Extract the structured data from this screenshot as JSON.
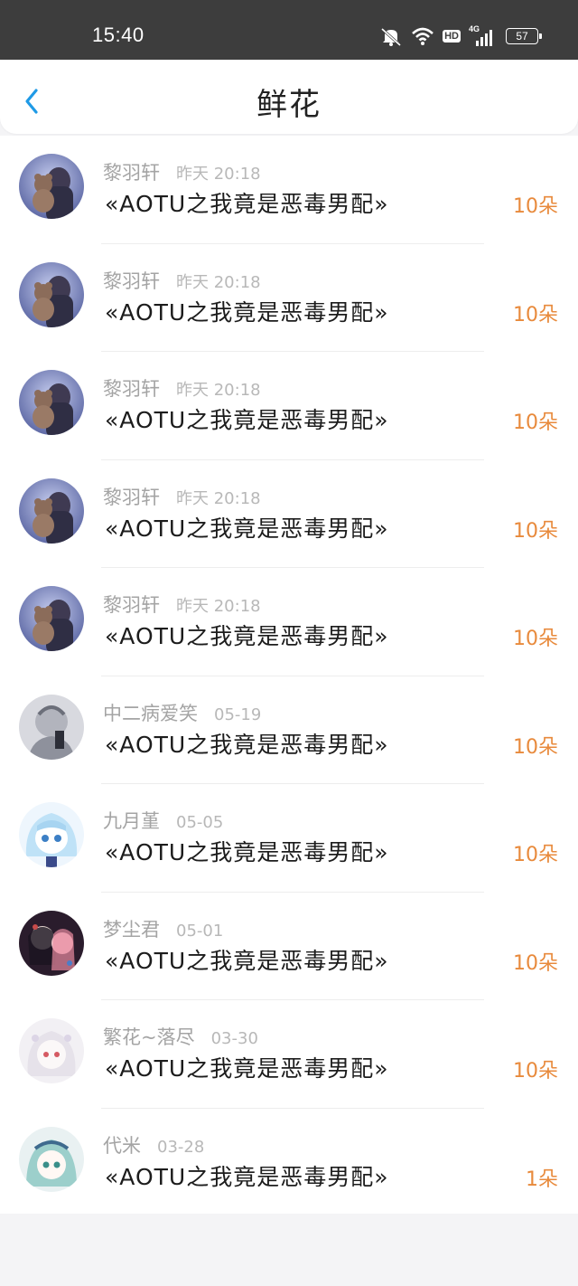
{
  "status_bar": {
    "time": "15:40",
    "battery": "57",
    "hd_label": "HD",
    "network_label": "4G",
    "icons": [
      "mute-icon",
      "wifi-icon",
      "hd-icon",
      "signal-icon",
      "battery-icon"
    ]
  },
  "header": {
    "title": "鲜花",
    "back_icon": "chevron-left-icon",
    "accent_color": "#1f9ae6"
  },
  "flowers": [
    {
      "user": "黎羽轩",
      "time": "昨天 20:18",
      "book": "«AOTU之我竟是恶毒男配»",
      "count": "10朵",
      "avatar": "avatar-bear"
    },
    {
      "user": "黎羽轩",
      "time": "昨天 20:18",
      "book": "«AOTU之我竟是恶毒男配»",
      "count": "10朵",
      "avatar": "avatar-bear"
    },
    {
      "user": "黎羽轩",
      "time": "昨天 20:18",
      "book": "«AOTU之我竟是恶毒男配»",
      "count": "10朵",
      "avatar": "avatar-bear"
    },
    {
      "user": "黎羽轩",
      "time": "昨天 20:18",
      "book": "«AOTU之我竟是恶毒男配»",
      "count": "10朵",
      "avatar": "avatar-bear"
    },
    {
      "user": "黎羽轩",
      "time": "昨天 20:18",
      "book": "«AOTU之我竟是恶毒男配»",
      "count": "10朵",
      "avatar": "avatar-bear"
    },
    {
      "user": "中二病爱笑",
      "time": "05-19",
      "book": "«AOTU之我竟是恶毒男配»",
      "count": "10朵",
      "avatar": "avatar-sketch"
    },
    {
      "user": "九月堇",
      "time": "05-05",
      "book": "«AOTU之我竟是恶毒男配»",
      "count": "10朵",
      "avatar": "avatar-blue-hair"
    },
    {
      "user": "梦尘君",
      "time": "05-01",
      "book": "«AOTU之我竟是恶毒男配»",
      "count": "10朵",
      "avatar": "avatar-dark"
    },
    {
      "user": "繁花~落尽",
      "time": "03-30",
      "book": "«AOTU之我竟是恶毒男配»",
      "count": "10朵",
      "avatar": "avatar-white"
    },
    {
      "user": "代米",
      "time": "03-28",
      "book": "«AOTU之我竟是恶毒男配»",
      "count": "1朵",
      "avatar": "avatar-teal"
    }
  ],
  "colors": {
    "count": "#e88a3c",
    "status_bar": "#3d3d3d",
    "page_bg": "#f4f4f6"
  }
}
